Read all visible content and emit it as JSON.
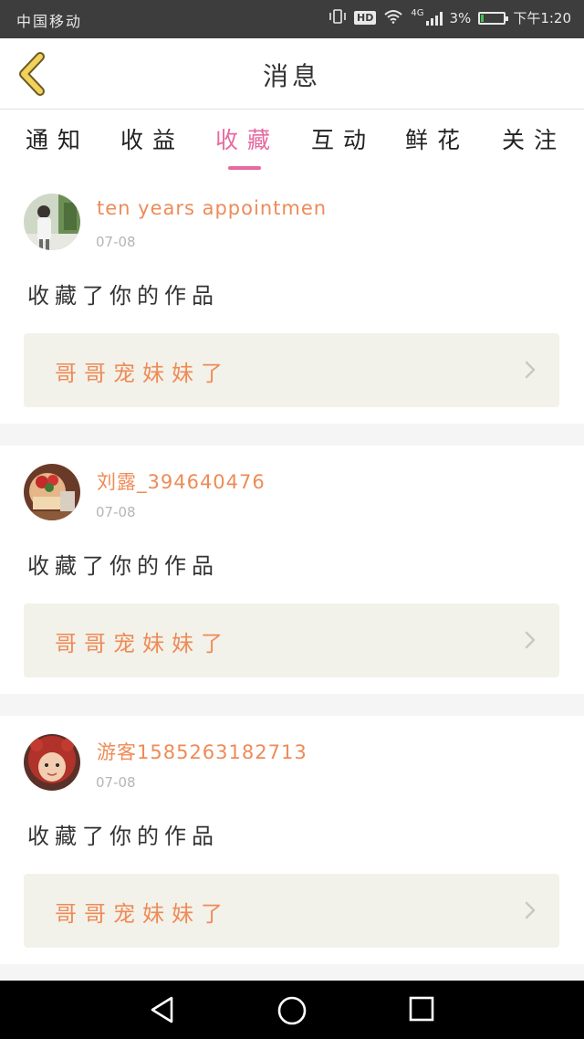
{
  "status_bar": {
    "carrier": "中国移动",
    "network": "4G",
    "hd": "HD",
    "battery": "3%",
    "time": "下午1:20"
  },
  "header": {
    "title": "消息",
    "back_icon": "chevron-left-icon"
  },
  "tabs": [
    {
      "label": "通知"
    },
    {
      "label": "收益"
    },
    {
      "label": "收藏",
      "active": true
    },
    {
      "label": "互动"
    },
    {
      "label": "鲜花"
    },
    {
      "label": "关注"
    }
  ],
  "cards": [
    {
      "username": "ten years appointmen",
      "date": "07-08",
      "action": "收藏了你的作品",
      "work_title": "哥哥宠妹妹了"
    },
    {
      "username": "刘露_394640476",
      "date": "07-08",
      "action": "收藏了你的作品",
      "work_title": "哥哥宠妹妹了"
    },
    {
      "username": "游客1585263182713",
      "date": "07-08",
      "action": "收藏了你的作品",
      "work_title": "哥哥宠妹妹了"
    }
  ],
  "colors": {
    "accent_pink": "#e66aa0",
    "username_orange": "#ee8b57",
    "back_yellow": "#f2d15c"
  },
  "nav": {
    "back_icon": "triangle-back-icon",
    "home_icon": "circle-home-icon",
    "recent_icon": "square-recent-icon"
  }
}
